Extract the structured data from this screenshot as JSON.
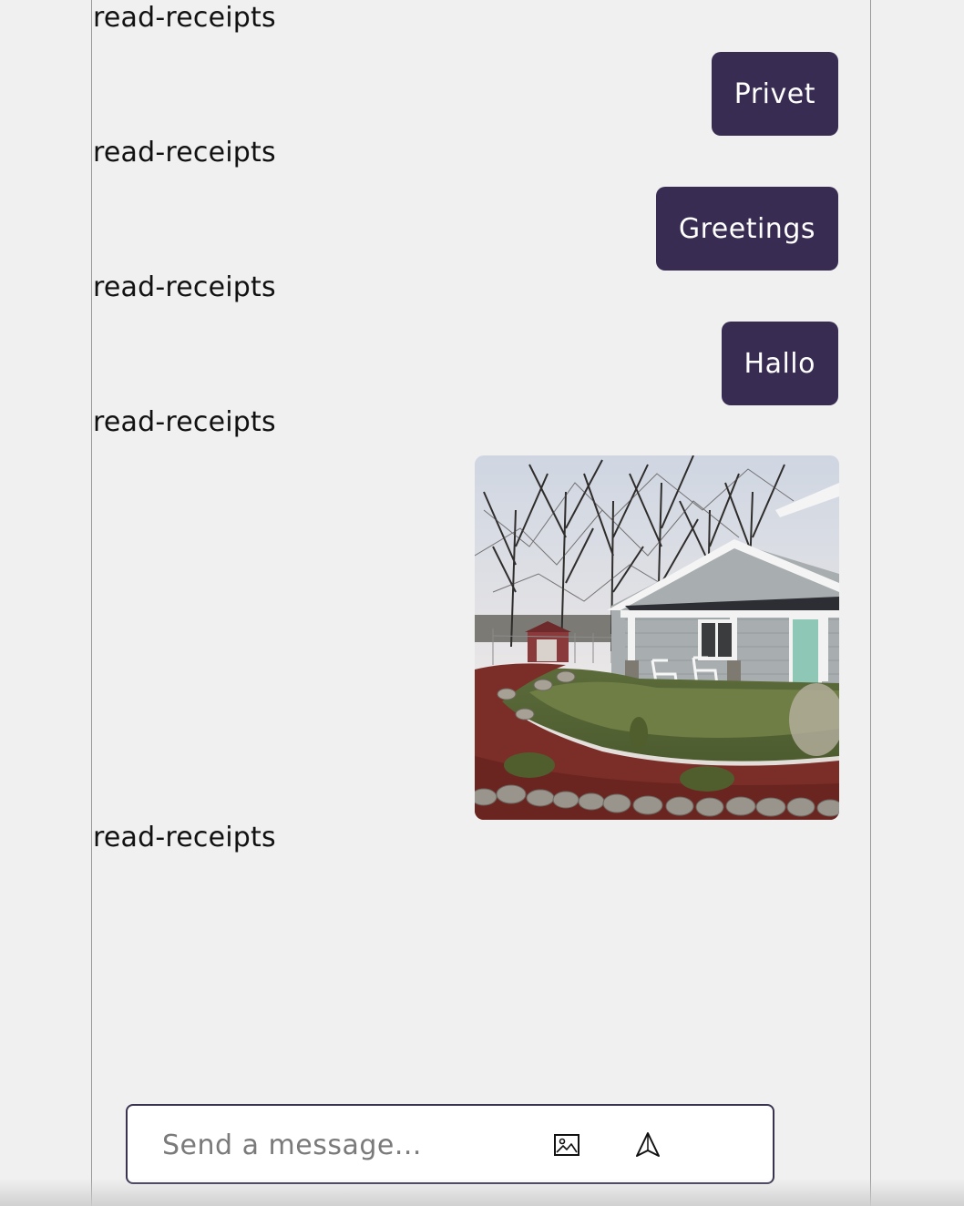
{
  "messages": [
    {
      "type": "text",
      "text": "Privet"
    },
    {
      "type": "text",
      "text": "Greetings"
    },
    {
      "type": "text",
      "text": "Hallo"
    },
    {
      "type": "image"
    }
  ],
  "receipt_label": "read-receipts",
  "composer": {
    "placeholder": "Send a message...",
    "attach_icon": "image-icon",
    "send_icon": "send-arrow-icon"
  },
  "colors": {
    "bubble": "#382c52",
    "bubble_text": "#ffffff",
    "background": "#f0f0f0"
  }
}
